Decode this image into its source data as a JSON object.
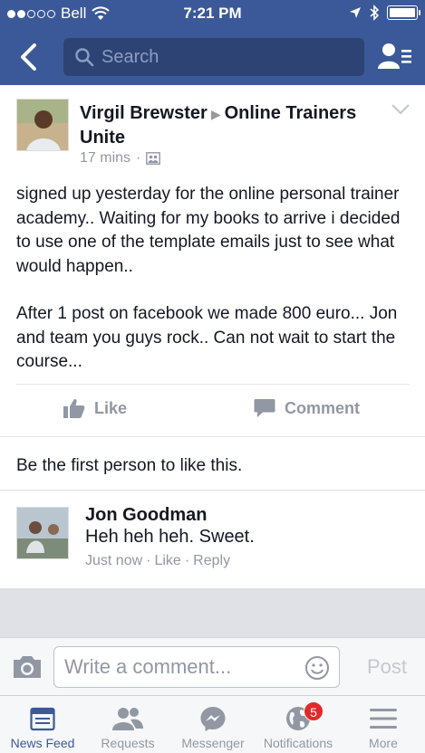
{
  "status": {
    "carrier": "Bell",
    "time": "7:21 PM"
  },
  "header": {
    "search_placeholder": "Search"
  },
  "post": {
    "author": "Virgil Brewster",
    "group": "Online Trainers Unite",
    "time": "17 mins",
    "paragraph1": "signed up yesterday for the online personal trainer academy.. Waiting for my books to arrive i decided to use one of the template emails just to see what would happen..",
    "paragraph2": "After 1 post on facebook we made 800 euro... Jon and team you guys rock.. Can not wait to start the course...",
    "like_label": "Like",
    "comment_label": "Comment",
    "likes_text": "Be the first person to like this."
  },
  "comment": {
    "author": "Jon Goodman",
    "text": "Heh heh heh. Sweet.",
    "time": "Just now",
    "like": "Like",
    "reply": "Reply"
  },
  "composer": {
    "placeholder": "Write a comment...",
    "post_label": "Post"
  },
  "tabs": [
    {
      "label": "News Feed",
      "icon": "news-feed-icon",
      "active": true
    },
    {
      "label": "Requests",
      "icon": "requests-icon"
    },
    {
      "label": "Messenger",
      "icon": "messenger-icon"
    },
    {
      "label": "Notifications",
      "icon": "globe-icon",
      "badge": "5"
    },
    {
      "label": "More",
      "icon": "menu-icon"
    }
  ],
  "colors": {
    "brand": "#3b5998",
    "badge": "#e02a2a"
  }
}
